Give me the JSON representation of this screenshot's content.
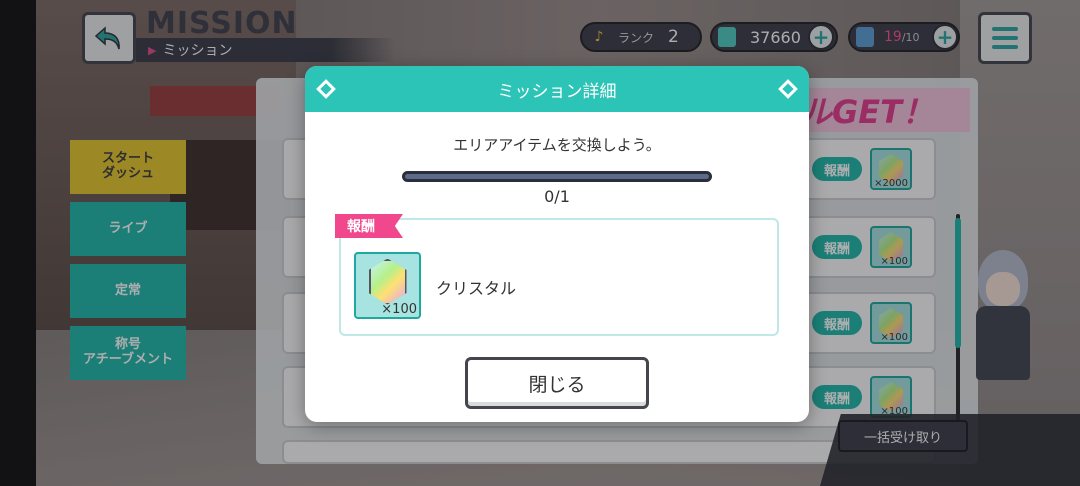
{
  "header": {
    "title": "MISSION",
    "subtitle": "ミッション",
    "rank_label": "ランク",
    "rank_value": "2",
    "crystal_value": "37660",
    "ticket_current": "19",
    "ticket_max": "/10"
  },
  "tabs": [
    {
      "label": "スタート\nダッシュ"
    },
    {
      "label": "ライブ"
    },
    {
      "label": "定常"
    },
    {
      "label": "称号\nアチーブメント"
    }
  ],
  "background_panel": {
    "banner_text": "ルGET！",
    "reward_tag": "報酬",
    "rows": [
      {
        "qty": "×2000"
      },
      {
        "qty": "×100"
      },
      {
        "qty": "×100"
      },
      {
        "qty": "×100"
      }
    ],
    "bulk_button": "一括受け取り"
  },
  "modal": {
    "title": "ミッション詳細",
    "description": "エリアアイテムを交換しよう。",
    "progress_text": "0/1",
    "progress_fraction": 0,
    "reward_ribbon": "報酬",
    "reward_qty": "×100",
    "reward_name": "クリスタル",
    "close_button": "閉じる"
  },
  "colors": {
    "accent_teal": "#2cc4b6",
    "pink": "#f0478d",
    "dark": "#3b3d48"
  }
}
